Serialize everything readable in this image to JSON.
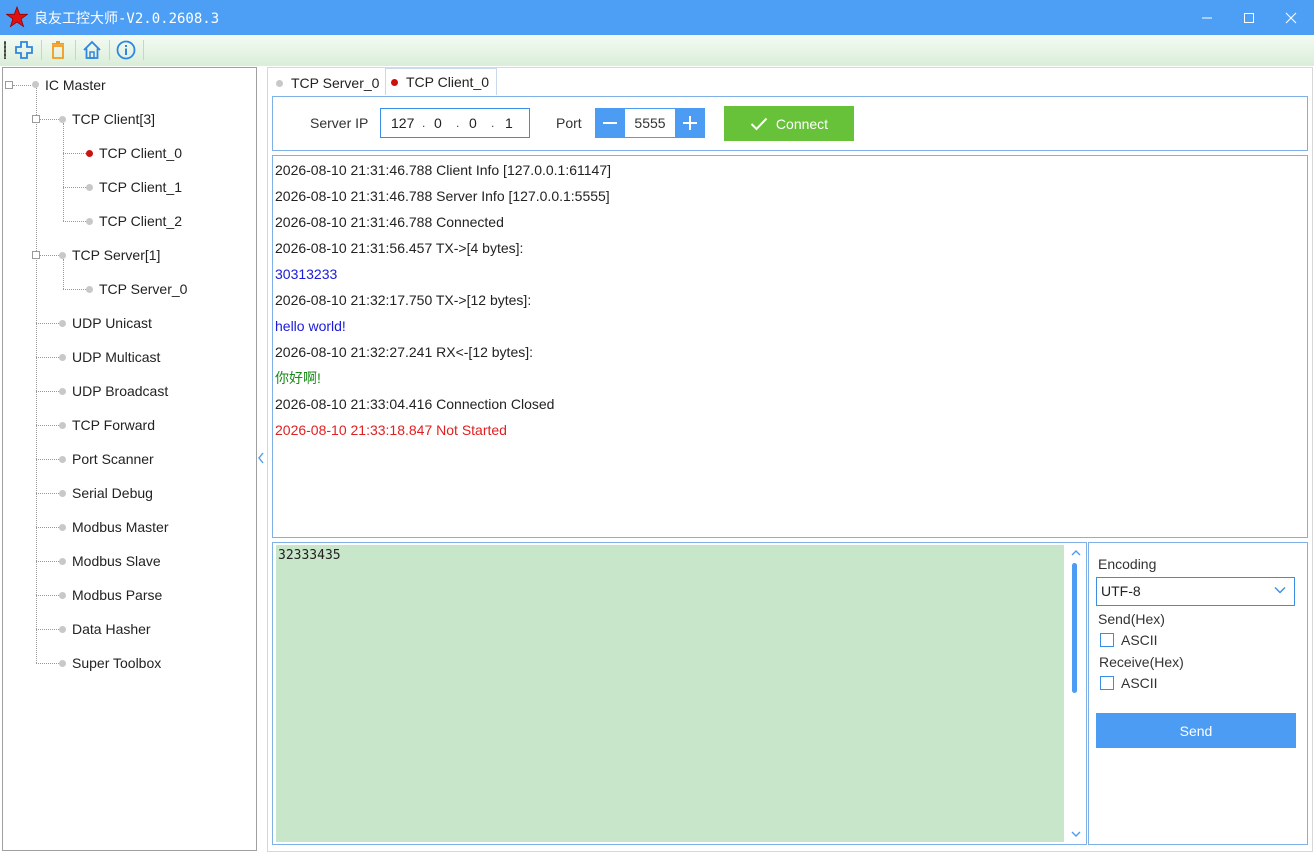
{
  "window": {
    "title": "良友工控大师-V2.0.2608.3",
    "colors": {
      "titlebar": "#4d9ff5",
      "accent": "#4b9cf2",
      "connect": "#67c23a",
      "send_area": "#c8e6c9"
    }
  },
  "toolbar": {
    "icons": [
      "add-icon",
      "delete-icon",
      "home-icon",
      "info-icon"
    ]
  },
  "tree": {
    "root": "IC Master",
    "items": [
      {
        "label": "TCP Client[3]"
      },
      {
        "label": "TCP Client_0",
        "active": true
      },
      {
        "label": "TCP Client_1"
      },
      {
        "label": "TCP Client_2"
      },
      {
        "label": "TCP Server[1]"
      },
      {
        "label": "TCP Server_0"
      },
      {
        "label": "UDP Unicast"
      },
      {
        "label": "UDP Multicast"
      },
      {
        "label": "UDP Broadcast"
      },
      {
        "label": "TCP Forward"
      },
      {
        "label": "Port Scanner"
      },
      {
        "label": "Serial Debug"
      },
      {
        "label": "Modbus Master"
      },
      {
        "label": "Modbus Slave"
      },
      {
        "label": "Modbus Parse"
      },
      {
        "label": "Data Hasher"
      },
      {
        "label": "Super Toolbox"
      }
    ]
  },
  "tabs": [
    {
      "label": "TCP Server_0",
      "active": false
    },
    {
      "label": "TCP Client_0",
      "active": true
    }
  ],
  "connection": {
    "server_ip_label": "Server IP",
    "ip": [
      "127",
      "0",
      "0",
      "1"
    ],
    "port_label": "Port",
    "port": "5555",
    "connect_label": "Connect"
  },
  "log": [
    {
      "text": "2026-08-10 21:31:46.788 Client Info [127.0.0.1:61147]",
      "color": "#222222"
    },
    {
      "text": "2026-08-10 21:31:46.788 Server Info [127.0.0.1:5555]",
      "color": "#222222"
    },
    {
      "text": "2026-08-10 21:31:46.788 Connected",
      "color": "#222222"
    },
    {
      "text": "2026-08-10 21:31:56.457 TX->[4 bytes]:",
      "color": "#222222"
    },
    {
      "text": "30313233",
      "color": "#1a1adb"
    },
    {
      "text": "2026-08-10 21:32:17.750 TX->[12 bytes]:",
      "color": "#222222"
    },
    {
      "text": "hello world!",
      "color": "#1a1adb"
    },
    {
      "text": "2026-08-10 21:32:27.241 RX<-[12 bytes]:",
      "color": "#222222"
    },
    {
      "text": "你好啊!",
      "color": "#1a8a1a"
    },
    {
      "text": "2026-08-10 21:33:04.416 Connection Closed",
      "color": "#222222"
    },
    {
      "text": "2026-08-10 21:33:18.847 Not Started",
      "color": "#e02020"
    }
  ],
  "send": {
    "text": "32333435"
  },
  "options": {
    "encoding_label": "Encoding",
    "encoding_value": "UTF-8",
    "send_hex_label": "Send(Hex)",
    "send_ascii_label": "ASCII",
    "send_ascii_checked": false,
    "receive_hex_label": "Receive(Hex)",
    "receive_ascii_label": "ASCII",
    "receive_ascii_checked": false,
    "send_button_label": "Send"
  }
}
